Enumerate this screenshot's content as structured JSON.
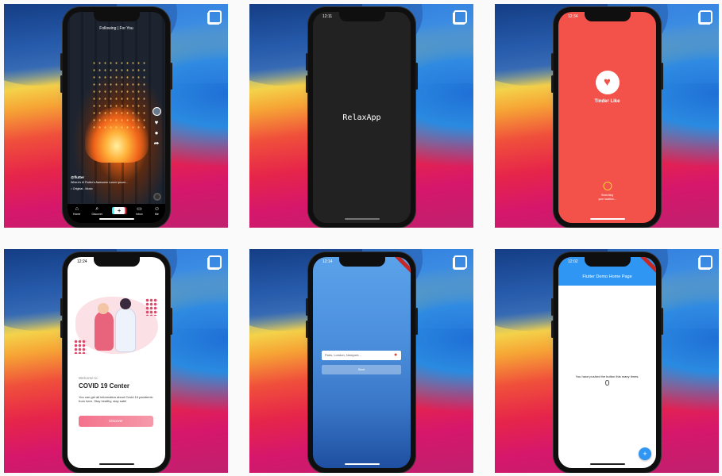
{
  "tiles": [
    {
      "id": "tiktok",
      "status_time": "",
      "top_header": "Following | For You",
      "side_counts": [
        "",
        "",
        "",
        ""
      ],
      "caption_user": "@flutter",
      "caption_desc": "Where's it! Flutter's Awesome Lorem ipsum...",
      "music": "♪ Original - Music",
      "tabs": [
        {
          "icon": "⌂",
          "label": "Home"
        },
        {
          "icon": "⌕",
          "label": "Discover"
        },
        {
          "icon": "+",
          "label": ""
        },
        {
          "icon": "▭",
          "label": "Inbox"
        },
        {
          "icon": "☺",
          "label": "Me"
        }
      ]
    },
    {
      "id": "relax",
      "status_time": "12:11",
      "title": "RelaxApp"
    },
    {
      "id": "tinder",
      "status_time": "12:34",
      "title": "Tinder Like",
      "status_text_1": "Searching",
      "status_text_2": "your location..."
    },
    {
      "id": "covid",
      "status_time": "12:24",
      "welcome": "Welcome to",
      "heading": "COVID 19 Center",
      "paragraph": "You can get all information about Covid 19 pandemic from here. Stay healthy, stay safe!",
      "button": "Discover"
    },
    {
      "id": "weather",
      "status_time": "12:14",
      "search_placeholder": "Paris, London, Newyork...",
      "start_button": "Start"
    },
    {
      "id": "counter",
      "status_time": "12:02",
      "app_title": "Flutter Demo Home Page",
      "message": "You have pushed the button this many times:",
      "count": "0",
      "fab_label": "+"
    }
  ],
  "colors": {
    "tinder_red": "#f2524a",
    "flutter_blue": "#2f96f3",
    "relax_bg": "#222222",
    "covid_pink": "#f4728b"
  }
}
